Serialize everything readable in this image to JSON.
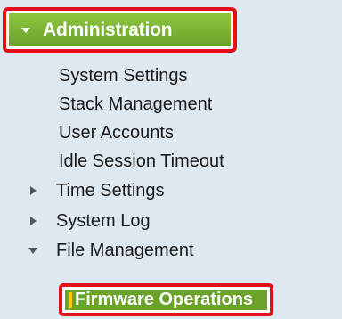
{
  "menu": {
    "section": {
      "label": "Administration",
      "icon": "chevron-down-icon"
    },
    "items": [
      {
        "label": "System Settings"
      },
      {
        "label": "Stack Management"
      },
      {
        "label": "User Accounts"
      },
      {
        "label": "Idle Session Timeout"
      }
    ],
    "groups": [
      {
        "label": "Time Settings",
        "icon": "expand-right-icon",
        "state": "collapsed"
      },
      {
        "label": "System Log",
        "icon": "expand-right-icon",
        "state": "collapsed"
      },
      {
        "label": "File Management",
        "icon": "collapse-down-icon",
        "state": "expanded"
      }
    ],
    "selected": {
      "label": "Firmware Operations"
    }
  },
  "colors": {
    "panel_bg": "#dde8f1",
    "header_green": "#8cc63f",
    "selected_green": "#6aa22a",
    "highlight_red": "#e1101b",
    "selected_marker": "#ffd000"
  }
}
